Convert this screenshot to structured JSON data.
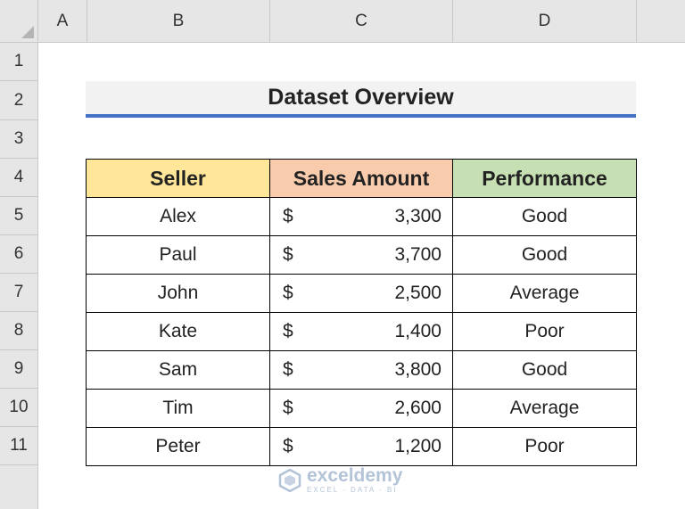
{
  "columns": [
    "A",
    "B",
    "C",
    "D"
  ],
  "rows": [
    "1",
    "2",
    "3",
    "4",
    "5",
    "6",
    "7",
    "8",
    "9",
    "10",
    "11"
  ],
  "title": "Dataset Overview",
  "table": {
    "headers": [
      "Seller",
      "Sales Amount",
      "Performance"
    ],
    "currency_symbol": "$",
    "rows": [
      {
        "seller": "Alex",
        "amount": "3,300",
        "performance": "Good"
      },
      {
        "seller": "Paul",
        "amount": "3,700",
        "performance": "Good"
      },
      {
        "seller": "John",
        "amount": "2,500",
        "performance": "Average"
      },
      {
        "seller": "Kate",
        "amount": "1,400",
        "performance": "Poor"
      },
      {
        "seller": "Sam",
        "amount": "3,800",
        "performance": "Good"
      },
      {
        "seller": "Tim",
        "amount": "2,600",
        "performance": "Average"
      },
      {
        "seller": "Peter",
        "amount": "1,200",
        "performance": "Poor"
      }
    ]
  },
  "watermark": {
    "name": "exceldemy",
    "tagline": "EXCEL · DATA · BI"
  },
  "colors": {
    "header_seller": "#ffe699",
    "header_sales": "#f8cbad",
    "header_performance": "#c6e0b4",
    "title_underline": "#4472c4",
    "title_bg": "#f2f2f2"
  }
}
